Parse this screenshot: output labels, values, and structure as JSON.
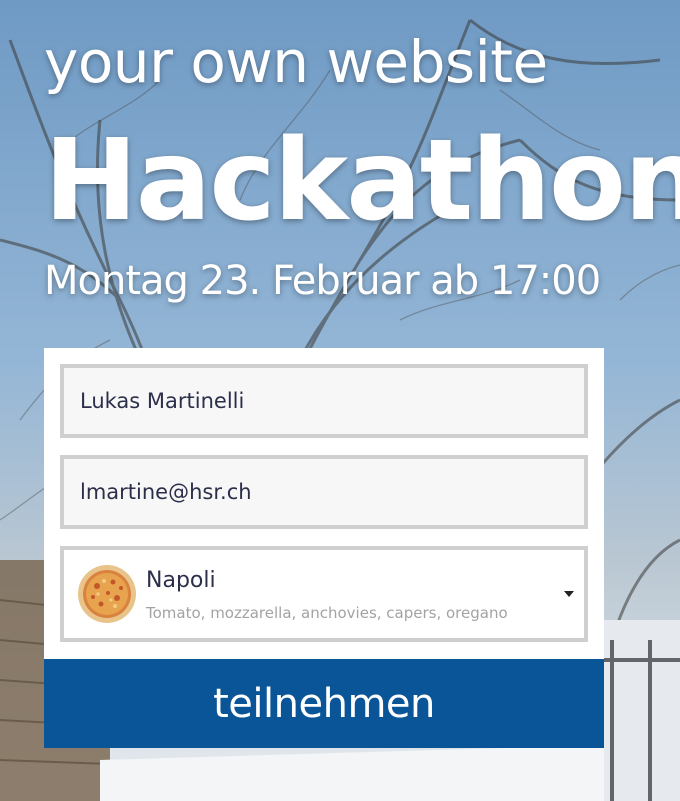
{
  "header": {
    "subtitle": "your own website",
    "title": "Hackathon",
    "date": "Montag 23. Februar ab 17:00"
  },
  "form": {
    "name_value": "Lukas Martinelli",
    "email_value": "lmartine@hsr.ch",
    "pizza_select": {
      "selected_title": "Napoli",
      "selected_description": "Tomato, mozzarella, anchovies, capers, oregano",
      "thumbnail_icon": "pizza-icon"
    },
    "submit_label": "teilnehmen"
  },
  "colors": {
    "accent": "#0a5597",
    "field_border": "#cfcfcf",
    "text_dark": "#2b2f4a",
    "text_muted": "#a3a3a3"
  }
}
